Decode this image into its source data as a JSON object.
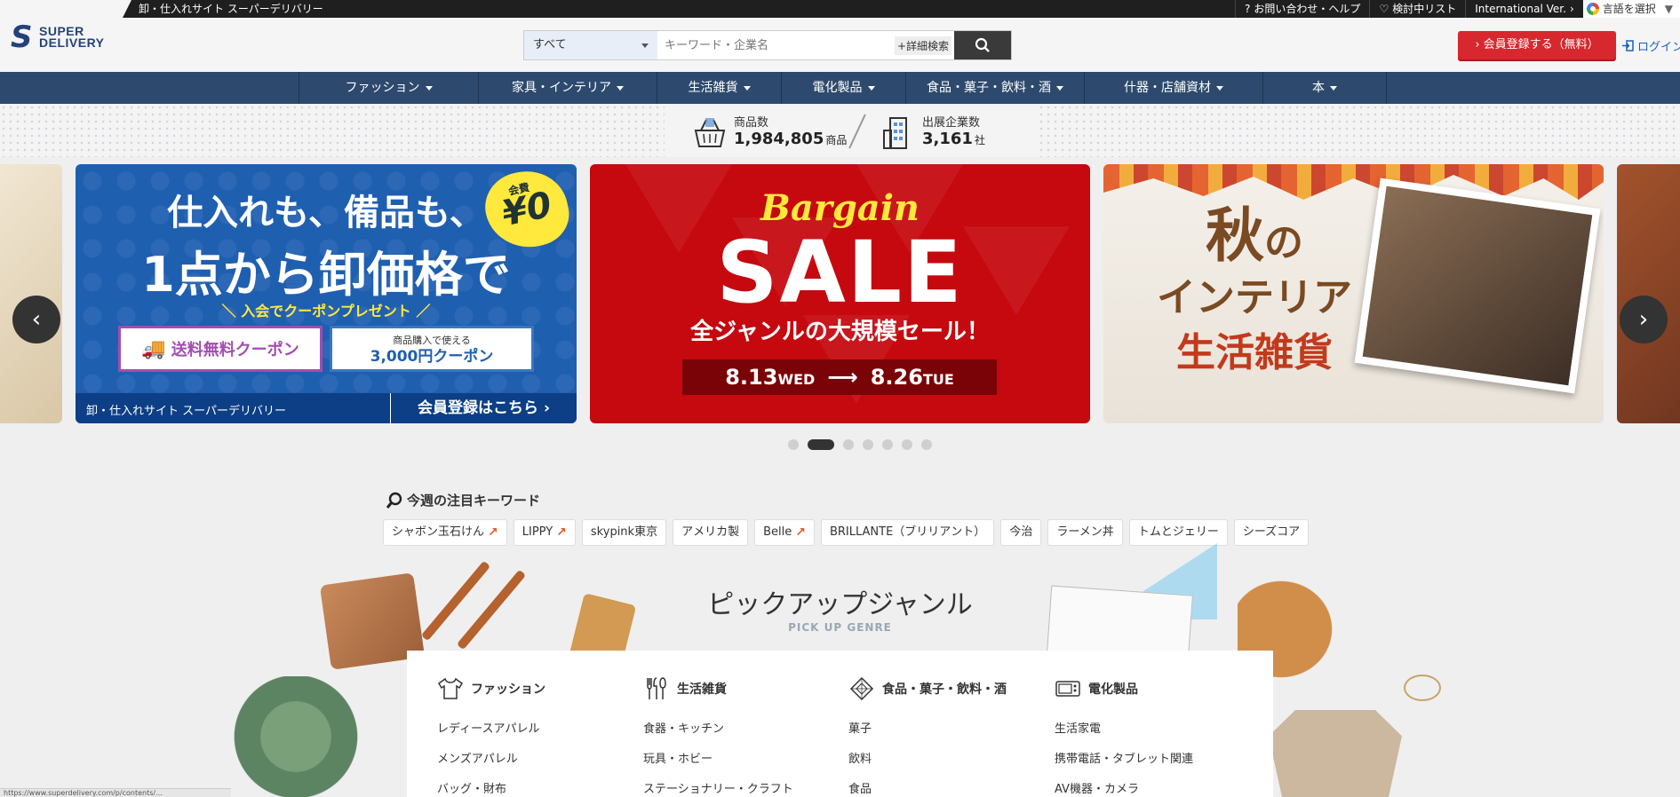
{
  "topbar": {
    "tagline": "卸・仕入れサイト スーパーデリバリー",
    "contact": "お問い合わせ・ヘルプ",
    "wishlist": "検討中リスト",
    "international": "International Ver.",
    "language": "言語を選択"
  },
  "logo": {
    "line1": "SUPER",
    "line2": "DELIVERY"
  },
  "search": {
    "category": "すべて",
    "placeholder": "キーワード・企業名",
    "advanced": "+詳細検索"
  },
  "header": {
    "register": "› 会員登録する（無料）",
    "login": "ログイン"
  },
  "nav": {
    "items": [
      "ファッション",
      "家具・インテリア",
      "生活雑貨",
      "電化製品",
      "食品・菓子・飲料・酒",
      "什器・店舗資材",
      "本"
    ]
  },
  "stats": {
    "products_label": "商品数",
    "products_value": "1,984,805",
    "products_unit": "商品",
    "companies_label": "出展企業数",
    "companies_value": "3,161",
    "companies_unit": "社"
  },
  "banners": {
    "b1": {
      "line1": "仕入れも、備品も、",
      "line2": "1点から卸価格で",
      "badge_small": "会費",
      "badge": "¥0",
      "present": "＼ 入会でクーポンプレゼント ／",
      "coupon1": "送料無料クーポン",
      "coupon2_small": "商品購入で使える",
      "coupon2": "3,000円クーポン",
      "footer_left": "卸・仕入れサイト スーパーデリバリー",
      "footer_right": "会員登録はこちら ›"
    },
    "b2": {
      "bargain": "Bargain",
      "sale": "SALE",
      "sub": "全ジャンルの大規模セール！",
      "date_start": "8.13",
      "dow_start": "WED",
      "arrow": "⟶",
      "date_end": "8.26",
      "dow_end": "TUE"
    },
    "b3": {
      "line1": "秋",
      "line1b": "の",
      "line2": "インテリア",
      "line3": "生活雑貨"
    }
  },
  "carousel": {
    "prev": "‹",
    "next": "›",
    "slides": 7,
    "active": 1
  },
  "keywords": {
    "title": "今週の注目キーワード",
    "items": [
      {
        "label": "シャボン玉石けん",
        "trending": true
      },
      {
        "label": "LIPPY",
        "trending": true
      },
      {
        "label": "skypink東京",
        "trending": false
      },
      {
        "label": "アメリカ製",
        "trending": false
      },
      {
        "label": "Belle",
        "trending": true
      },
      {
        "label": "BRILLANTE（ブリリアント）",
        "trending": false
      },
      {
        "label": "今治",
        "trending": false
      },
      {
        "label": "ラーメン丼",
        "trending": false
      },
      {
        "label": "トムとジェリー",
        "trending": false
      },
      {
        "label": "シーズコア",
        "trending": false
      }
    ],
    "trend_icon": "↗"
  },
  "pickup": {
    "title": "ピックアップジャンル",
    "subtitle": "PICK UP GENRE",
    "columns": [
      {
        "head": "ファッション",
        "icon": "shirt-icon",
        "items": [
          "レディースアパレル",
          "メンズアパレル",
          "バッグ・財布"
        ]
      },
      {
        "head": "生活雑貨",
        "icon": "utensils-icon",
        "items": [
          "食器・キッチン",
          "玩具・ホビー",
          "ステーショナリー・クラフト"
        ]
      },
      {
        "head": "食品・菓子・飲料・酒",
        "icon": "food-icon",
        "items": [
          "菓子",
          "飲料",
          "食品"
        ]
      },
      {
        "head": "電化製品",
        "icon": "appliance-icon",
        "items": [
          "生活家電",
          "携帯電話・タブレット関連",
          "AV機器・カメラ"
        ]
      }
    ]
  },
  "statusbar": {
    "url": "https://www.superdelivery.com/p/contents/..."
  },
  "colors": {
    "nav": "#2d4a6e",
    "register": "#d6282e",
    "accent_blue": "#1f5fb0",
    "sale_red": "#c5090f"
  }
}
